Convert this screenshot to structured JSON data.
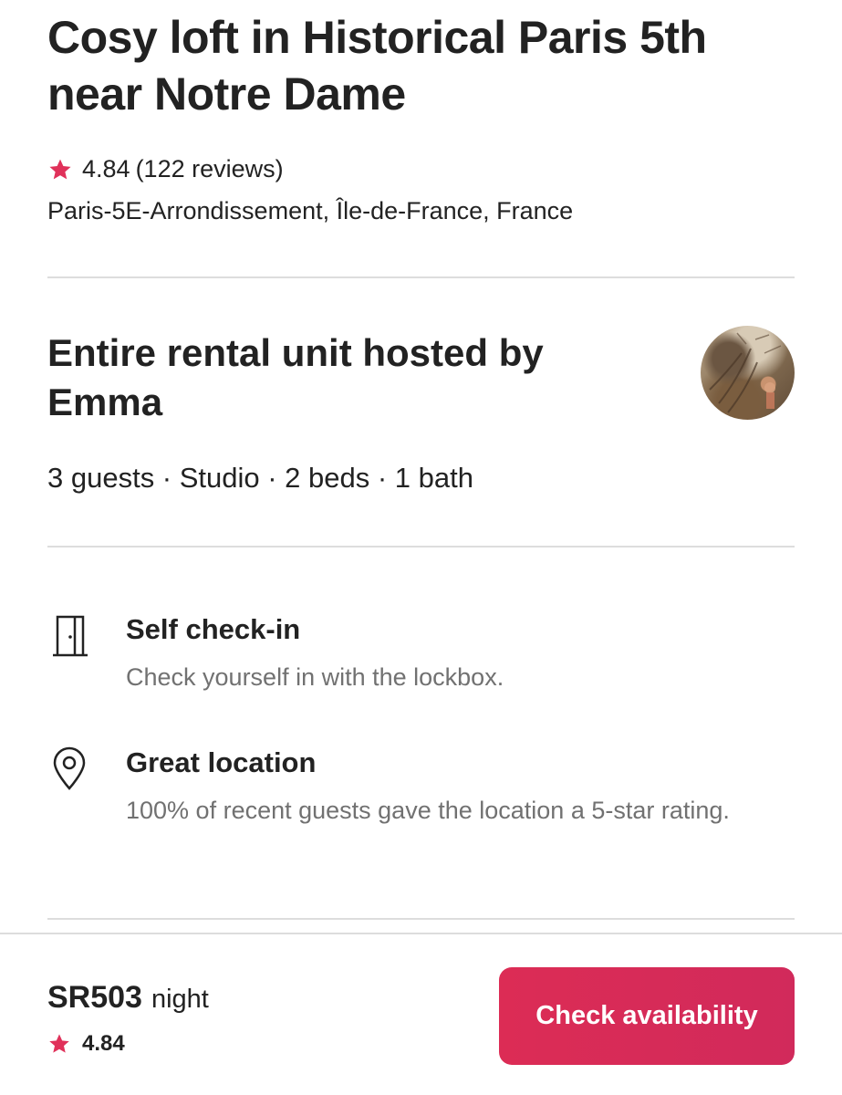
{
  "listing": {
    "title": "Cosy loft in Historical Paris 5th near Notre Dame",
    "rating": "4.84",
    "reviews": "(122 reviews)",
    "location": "Paris-5E-Arrondissement, Île-de-France, France"
  },
  "host": {
    "title": "Entire rental unit hosted by Emma",
    "avatar_icon": "host-avatar"
  },
  "details": "3 guests · Studio · 2 beds · 1 bath",
  "features": [
    {
      "icon": "door-icon",
      "title": "Self check-in",
      "description": "Check yourself in with the lockbox."
    },
    {
      "icon": "location-pin-icon",
      "title": "Great location",
      "description": "100% of recent guests gave the location a 5-star rating."
    }
  ],
  "booking": {
    "price": "SR503",
    "unit": "night",
    "rating": "4.84",
    "cta_label": "Check availability"
  },
  "colors": {
    "accent": "#dc2c55",
    "star": "#e0315a",
    "text": "#222222",
    "muted": "#717171",
    "divider": "#dddddd"
  }
}
